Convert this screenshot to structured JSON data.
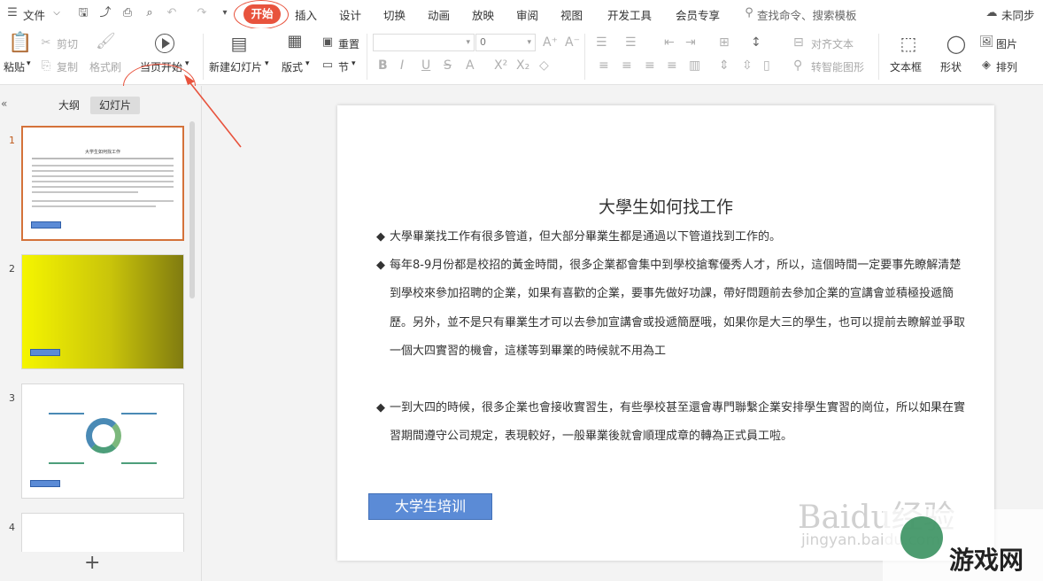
{
  "menubar": {
    "file_label": "文件",
    "tabs": [
      "开始",
      "插入",
      "设计",
      "切换",
      "动画",
      "放映",
      "审阅",
      "视图",
      "开发工具",
      "会员专享"
    ],
    "search_placeholder": "查找命令、搜索模板",
    "sync_label": "未同步"
  },
  "ribbon": {
    "paste": "粘贴",
    "cut": "剪切",
    "copy": "复制",
    "format_painter": "格式刷",
    "from_current": "当页开始",
    "new_slide": "新建幻灯片",
    "layout": "版式",
    "reset": "重置",
    "section": "节",
    "font_size": "0",
    "align_text": "对齐文本",
    "smart_art": "转智能图形",
    "textbox": "文本框",
    "shape": "形状",
    "picture": "图片",
    "arrange": "排列"
  },
  "leftpanel": {
    "tab_outline": "大纲",
    "tab_slides": "幻灯片",
    "slide_numbers": [
      "1",
      "2",
      "3",
      "4"
    ],
    "add_label": "+"
  },
  "slide": {
    "title": "大學生如何找工作",
    "bullets": [
      "大學畢業找工作有很多管道，但大部分畢業生都是通過以下管道找到工作的。",
      "每年8-9月份都是校招的黃金時間，很多企業都會集中到學校搶奪優秀人才，所以，這個時間一定要事先瞭解清楚到學校來參加招聘的企業，如果有喜歡的企業，要事先做好功課，帶好問題前去參加企業的宣講會並積極投遞簡歷。另外，並不是只有畢業生才可以去參加宣講會或投遞簡歷哦，如果你是大三的學生，也可以提前去瞭解並爭取一個大四實習的機會，這樣等到畢業的時候就不用為工",
      "一到大四的時候，很多企業也會接收實習生，有些學校甚至還會專門聯繫企業安排學生實習的崗位，所以如果在實習期間遵守公司規定，表現較好，一般畢業後就會順理成章的轉為正式員工啦。"
    ],
    "tag": "大学生培训"
  },
  "watermark": {
    "baidu": "Baidu经验",
    "jingyan": "jingyan.baidu.com",
    "site": "游戏网"
  }
}
